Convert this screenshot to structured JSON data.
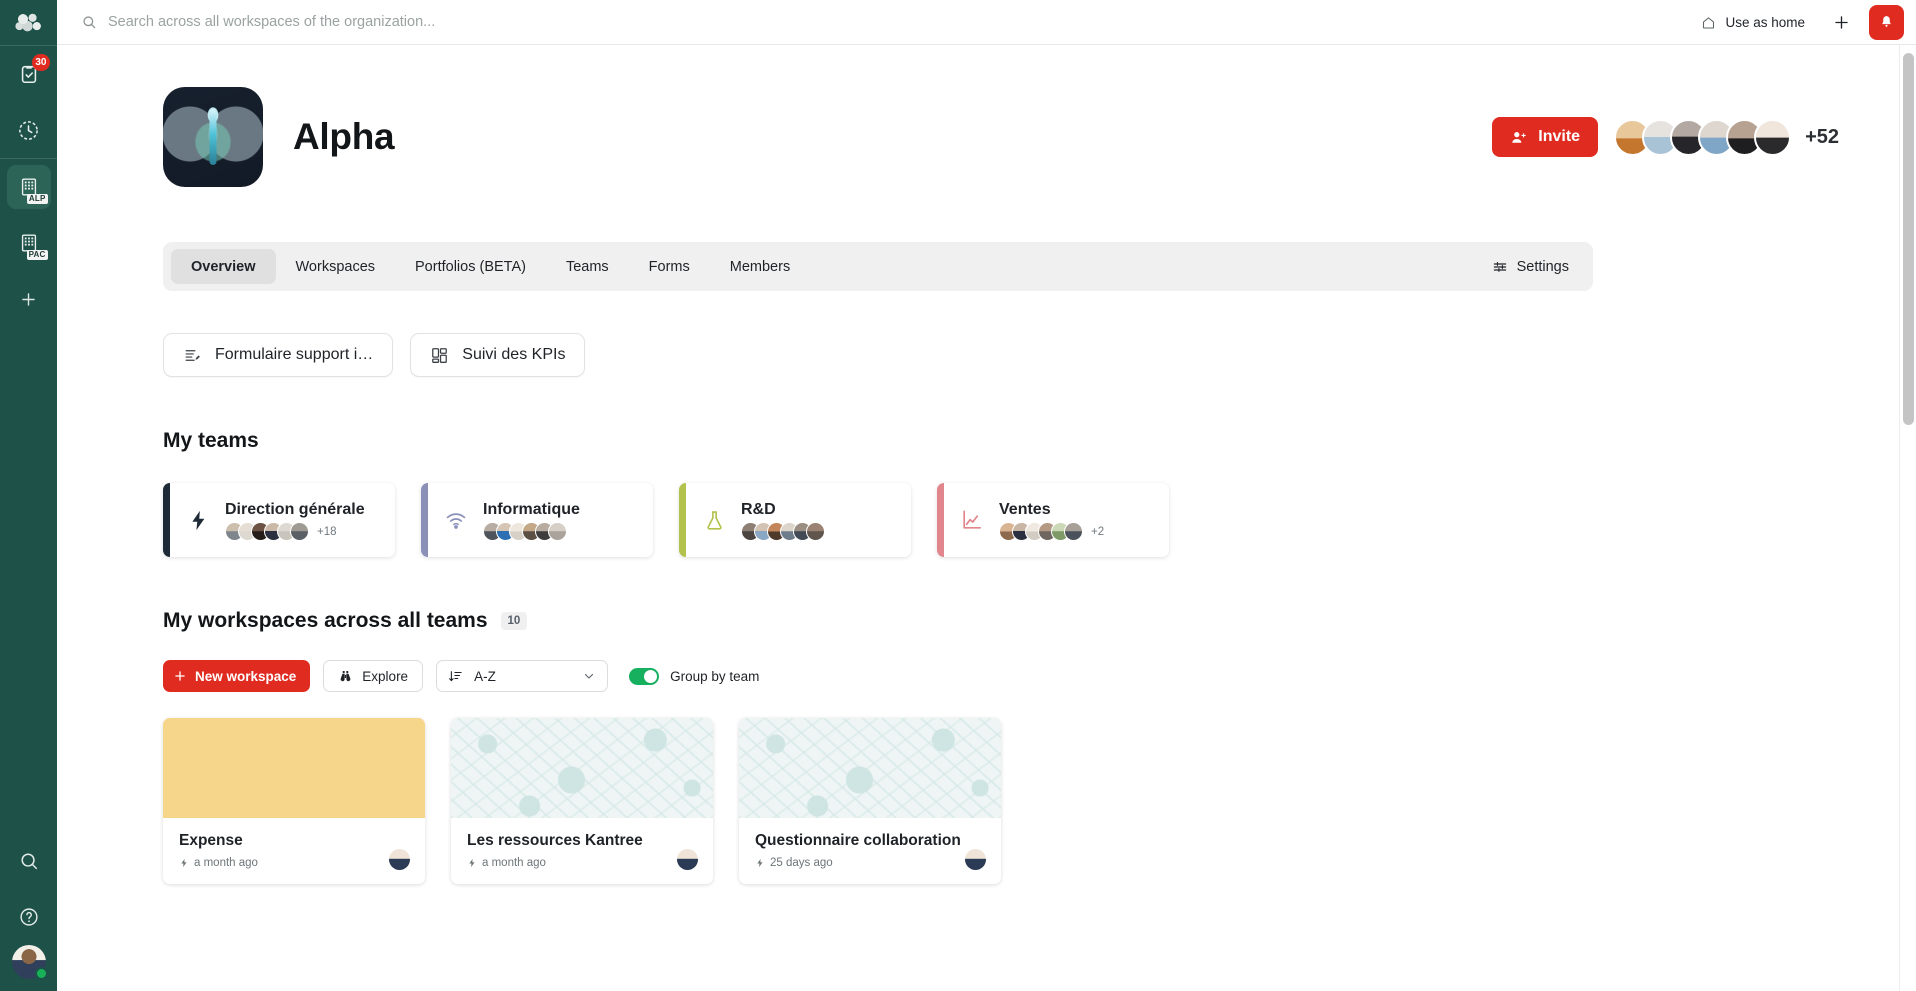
{
  "sidebar": {
    "logo_name": "organization-logo",
    "items": [
      {
        "name": "tasks",
        "icon": "clipboard-check-icon",
        "badge": "30",
        "code": ""
      },
      {
        "name": "recent",
        "icon": "clock-icon",
        "badge": "",
        "code": ""
      },
      {
        "name": "workspace-alp",
        "icon": "building-icon",
        "badge": "",
        "code": "ALP",
        "selected": true
      },
      {
        "name": "workspace-pac",
        "icon": "building-icon",
        "badge": "",
        "code": "PAC",
        "selected": false
      },
      {
        "name": "add",
        "icon": "plus-icon",
        "badge": "",
        "code": ""
      }
    ],
    "bottom": [
      {
        "name": "search",
        "icon": "search-icon"
      },
      {
        "name": "help",
        "icon": "question-circle-icon"
      }
    ],
    "avatar_label": "current-user-avatar",
    "status": "online"
  },
  "topbar": {
    "search_placeholder": "Search across all workspaces of the organization...",
    "search_value": "",
    "use_as_home": "Use as home",
    "add_label": "+",
    "notifications_label": "notifications"
  },
  "org": {
    "title": "Alpha",
    "invite_label": "Invite",
    "member_overflow": "+52",
    "member_avatars": [
      "#d8a672",
      "#cfe0ea",
      "#3b3b3b",
      "#b9cde0",
      "#5c4a3e",
      "#e3dfe0"
    ]
  },
  "tabs": [
    {
      "label": "Overview",
      "active": true
    },
    {
      "label": "Workspaces",
      "active": false
    },
    {
      "label": "Portfolios (BETA)",
      "active": false
    },
    {
      "label": "Teams",
      "active": false
    },
    {
      "label": "Forms",
      "active": false
    },
    {
      "label": "Members",
      "active": false
    }
  ],
  "settings": {
    "label": "Settings",
    "icon": "sliders-icon"
  },
  "shortcuts": [
    {
      "label": "Formulaire support i…",
      "icon": "form-icon"
    },
    {
      "label": "Suivi des KPIs",
      "icon": "dashboard-icon"
    }
  ],
  "teams_section": {
    "title": "My teams",
    "cards": [
      {
        "name": "Direction générale",
        "color": "#1e2a35",
        "icon": "bolt-icon",
        "overflow": "+18",
        "avatars": [
          "#9aa4ac",
          "#e2ded6",
          "#3a2f2a",
          "#2b3240",
          "#d7d2cb",
          "#6b7078"
        ]
      },
      {
        "name": "Informatique",
        "color": "#8b90b8",
        "icon": "wifi-icon",
        "overflow": "",
        "avatars": [
          "#6d737b",
          "#2f6fb5",
          "#e6e2dc",
          "#7a6a55",
          "#4a4a4a",
          "#b9b3ab"
        ]
      },
      {
        "name": "R&D",
        "color": "#b3c14d",
        "icon": "flask-icon",
        "overflow": "",
        "avatars": [
          "#6e6a66",
          "#9fb6cf",
          "#c08a5e",
          "#7f8b9c",
          "#4f5a66",
          "#6e625a"
        ]
      },
      {
        "name": "Ventes",
        "color": "#e0868c",
        "icon": "chart-line-icon",
        "overflow": "+2",
        "avatars": [
          "#c7a07b",
          "#33384a",
          "#ddd8d2",
          "#9a8e83",
          "#8fae7a",
          "#57606b"
        ]
      }
    ]
  },
  "workspaces_section": {
    "title": "My workspaces across all teams",
    "count": "10",
    "new_workspace_label": "New workspace",
    "explore_label": "Explore",
    "sort_value": "A-Z",
    "sort_icon": "sort-icon",
    "group_by_team_label": "Group by team",
    "group_by_team_on": true,
    "cards": [
      {
        "name": "Expense",
        "time": "a month ago",
        "cover": "plain",
        "cover_color": "#f6d68b"
      },
      {
        "name": "Les ressources Kantree",
        "time": "a month ago",
        "cover": "pattern",
        "cover_color": "#eef5f4"
      },
      {
        "name": "Questionnaire collaboration",
        "time": "25 days ago",
        "cover": "pattern",
        "cover_color": "#eef5f4"
      }
    ]
  }
}
